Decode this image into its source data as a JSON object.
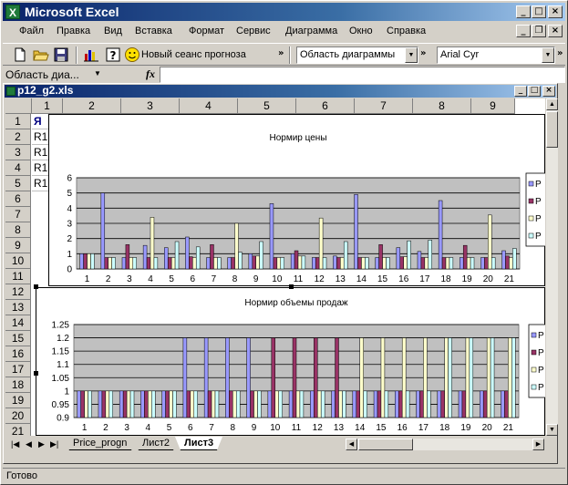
{
  "window": {
    "title": "Microsoft Excel",
    "icon": "excel-x-icon"
  },
  "menu": [
    "Файл",
    "Правка",
    "Вид",
    "Вставка",
    "Формат",
    "Сервис",
    "Диаграмма",
    "Окно",
    "Справка"
  ],
  "toolbar": {
    "forecast_label": "Новый сеанс прогноза",
    "chart_area_combo": "Область диаграммы",
    "font_combo": "Arial Cyr"
  },
  "formula_bar": {
    "name_box": "Область диа...",
    "fx_label": "fx",
    "value": ""
  },
  "workbook": {
    "title": "p12_g2.xls",
    "columns": [
      "1",
      "2",
      "3",
      "4",
      "5",
      "6",
      "7",
      "8",
      "9"
    ],
    "rows": [
      "1",
      "2",
      "3",
      "4",
      "5",
      "6",
      "7",
      "8",
      "9",
      "10",
      "11",
      "12",
      "13",
      "14",
      "15",
      "16",
      "17",
      "18",
      "19",
      "20",
      "21"
    ],
    "col1_cells": [
      "Я",
      "R1",
      "R1",
      "R1",
      "R1"
    ]
  },
  "sheets": [
    "Price_progn",
    "Лист2",
    "Лист3"
  ],
  "active_sheet": "Лист3",
  "status": "Готово",
  "colors": {
    "s1": "#9999ff",
    "s2": "#993366",
    "s3": "#ffffcc",
    "s4": "#ccffff",
    "plot_bg": "#c0c0c0"
  },
  "chart_data": [
    {
      "type": "bar",
      "title": "Нормир цены",
      "categories": [
        "1",
        "2",
        "3",
        "4",
        "5",
        "6",
        "7",
        "8",
        "9",
        "10",
        "11",
        "12",
        "13",
        "14",
        "15",
        "16",
        "17",
        "18",
        "19",
        "20",
        "21"
      ],
      "ylim": [
        0,
        6
      ],
      "yticks": [
        "0",
        "1",
        "2",
        "3",
        "4",
        "5",
        "6"
      ],
      "grid": true,
      "legend": "right",
      "legend_labels": [
        "Р",
        "Р",
        "Р",
        "Р"
      ],
      "series": [
        {
          "values": [
            1,
            5,
            0.75,
            1.55,
            1.4,
            2.1,
            0.75,
            0.75,
            1,
            4.3,
            1,
            0.75,
            0.85,
            4.9,
            0.75,
            1.4,
            1.15,
            4.5,
            0.75,
            0.75,
            1.2
          ]
        },
        {
          "values": [
            1,
            0.75,
            1.6,
            0.75,
            0.75,
            0.8,
            1.6,
            0.75,
            0.85,
            0.75,
            1.2,
            0.75,
            0.75,
            0.75,
            1.6,
            0.8,
            0.75,
            0.75,
            1.55,
            0.75,
            0.85
          ]
        },
        {
          "values": [
            1,
            0.75,
            0.75,
            3.4,
            0.75,
            0.75,
            0.75,
            3,
            0.85,
            0.75,
            0.85,
            3.35,
            0.75,
            0.75,
            0.75,
            0.8,
            0.75,
            0.75,
            0.75,
            3.55,
            0.75
          ]
        },
        {
          "values": [
            1,
            0.75,
            0.75,
            0.75,
            1.8,
            1.45,
            0.75,
            1.1,
            1.8,
            0.75,
            0.85,
            0.75,
            1.8,
            0.75,
            0.75,
            1.85,
            1.9,
            0.75,
            0.75,
            0.75,
            1.35
          ]
        }
      ]
    },
    {
      "type": "bar",
      "title": "Нормир объемы продаж",
      "categories": [
        "1",
        "2",
        "3",
        "4",
        "5",
        "6",
        "7",
        "8",
        "9",
        "10",
        "11",
        "12",
        "13",
        "14",
        "15",
        "16",
        "17",
        "18",
        "19",
        "20",
        "21"
      ],
      "ylim": [
        0.9,
        1.25
      ],
      "yticks": [
        "0.9",
        "0.95",
        "1",
        "1.05",
        "1.1",
        "1.15",
        "1.2",
        "1.25"
      ],
      "grid": true,
      "legend": "right",
      "legend_labels": [
        "Р",
        "Р",
        "Р",
        "Р"
      ],
      "series": [
        {
          "values": [
            1,
            1,
            1,
            1,
            1,
            1.2,
            1.2,
            1.2,
            1.2,
            1,
            1,
            1,
            1,
            1,
            1,
            1,
            1,
            1,
            1,
            1,
            1
          ]
        },
        {
          "values": [
            1,
            1,
            1,
            1,
            1,
            1,
            1,
            1,
            1,
            1.2,
            1.2,
            1.2,
            1.2,
            1,
            1,
            1,
            1,
            1,
            1,
            1,
            1
          ]
        },
        {
          "values": [
            1,
            1,
            1,
            1,
            1,
            1,
            1,
            1,
            1,
            1,
            1,
            1,
            1,
            1.2,
            1.2,
            1.2,
            1.2,
            1.2,
            1.2,
            1.2,
            1.2
          ]
        },
        {
          "values": [
            1,
            1,
            1,
            1,
            1,
            1,
            1,
            1,
            1,
            1,
            1,
            1,
            1,
            1,
            1,
            1,
            1,
            1.2,
            1.2,
            1.2,
            1.2
          ]
        }
      ]
    }
  ]
}
